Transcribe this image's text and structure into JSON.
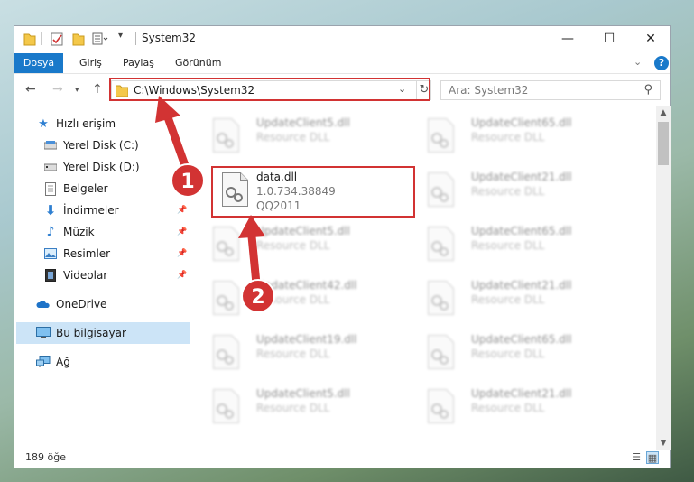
{
  "window": {
    "title": "System32",
    "minimize_glyph": "—",
    "maximize_glyph": "☐",
    "close_glyph": "✕"
  },
  "quick_access_toolbar": {
    "items": [
      "folder-icon",
      "properties-check-icon",
      "new-folder-icon",
      "layout-icon",
      "dropdown-chevron-icon"
    ]
  },
  "ribbon": {
    "tabs": [
      "Dosya",
      "Giriş",
      "Paylaş",
      "Görünüm"
    ],
    "help_glyph": "?"
  },
  "nav": {
    "address_path": "C:\\Windows\\System32",
    "search_placeholder": "Ara: System32"
  },
  "sidebar": {
    "items": [
      {
        "label": "Hızlı erişim",
        "icon": "star-icon",
        "pinned": false
      },
      {
        "label": "Yerel Disk (C:)",
        "icon": "drive-icon",
        "pinned": false
      },
      {
        "label": "Yerel Disk (D:)",
        "icon": "drive-icon",
        "pinned": false
      },
      {
        "label": "Belgeler",
        "icon": "documents-icon",
        "pinned": false
      },
      {
        "label": "İndirmeler",
        "icon": "download-icon",
        "pinned": true
      },
      {
        "label": "Müzik",
        "icon": "music-icon",
        "pinned": true
      },
      {
        "label": "Resimler",
        "icon": "pictures-icon",
        "pinned": true
      },
      {
        "label": "Videolar",
        "icon": "videos-icon",
        "pinned": true
      },
      {
        "label": "OneDrive",
        "icon": "onedrive-icon",
        "pinned": false
      },
      {
        "label": "Bu bilgisayar",
        "icon": "computer-icon",
        "pinned": false,
        "selected": true
      },
      {
        "label": "Ağ",
        "icon": "network-icon",
        "pinned": false
      }
    ]
  },
  "files": {
    "left_column": [
      {
        "name": "UpdateClient5.dll",
        "type": "Resource DLL"
      },
      {
        "name": "data.dll",
        "version": "1.0.734.38849",
        "company": "QQ2011",
        "highlighted": true
      },
      {
        "name": "UpdateClient5.dll",
        "type": "Resource DLL"
      },
      {
        "name": "UpdateClient42.dll",
        "type": "Resource DLL"
      },
      {
        "name": "UpdateClient19.dll",
        "type": "Resource DLL"
      },
      {
        "name": "UpdateClient5.dll",
        "type": "Resource DLL"
      }
    ],
    "right_column": [
      {
        "name": "UpdateClient65.dll",
        "type": "Resource DLL"
      },
      {
        "name": "UpdateClient21.dll",
        "type": "Resource DLL"
      },
      {
        "name": "UpdateClient65.dll",
        "type": "Resource DLL"
      },
      {
        "name": "UpdateClient21.dll",
        "type": "Resource DLL"
      },
      {
        "name": "UpdateClient65.dll",
        "type": "Resource DLL"
      },
      {
        "name": "UpdateClient21.dll",
        "type": "Resource DLL"
      }
    ]
  },
  "status": {
    "item_count": "189 öğe"
  },
  "annotations": {
    "step1": "1",
    "step2": "2",
    "color": "#d23333"
  }
}
